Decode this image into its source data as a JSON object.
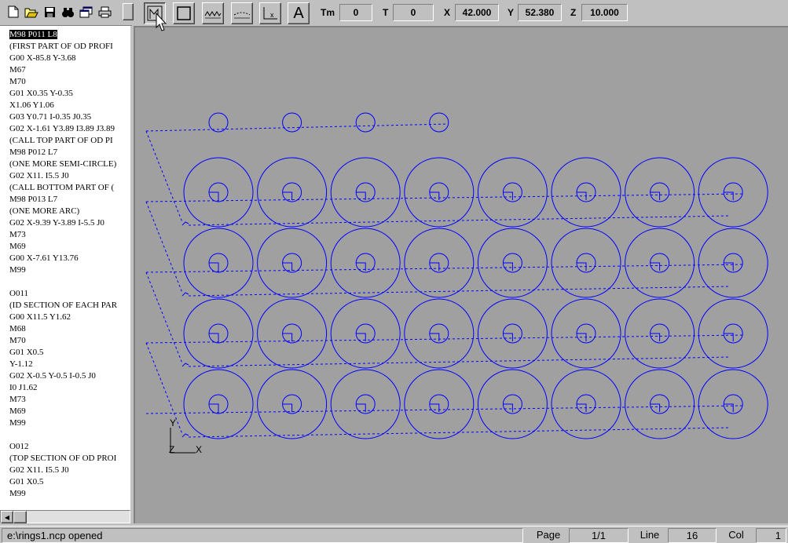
{
  "editor": {
    "lines": [
      "M98 P011 L8",
      "(FIRST PART OF OD PROFI",
      "G00 X-85.8 Y-3.68",
      "M67",
      "M70",
      "G01 X0.35 Y-0.35",
      "X1.06 Y1.06",
      "G03 Y0.71 I-0.35 J0.35",
      "G02 X-1.61 Y3.89 I3.89 J3.89",
      "(CALL TOP PART OF OD PI",
      "M98 P012 L7",
      "(ONE MORE SEMI-CIRCLE)",
      "G02 X11. I5.5 J0",
      "(CALL BOTTOM PART OF (",
      "M98 P013 L7",
      "(ONE MORE ARC)",
      "G02 X-9.39 Y-3.89 I-5.5 J0",
      "M73",
      "M69",
      "G00 X-7.61 Y13.76",
      "M99",
      "",
      "O011",
      "(ID SECTION OF EACH PAR",
      "G00 X11.5 Y1.62",
      "M68",
      "M70",
      "G01 X0.5",
      "Y-1.12",
      "G02 X-0.5 Y-0.5 I-0.5 J0",
      "I0 J1.62",
      "M73",
      "M69",
      "M99",
      "",
      "O012",
      "(TOP SECTION OF OD PROI",
      "G02 X11. I5.5 J0",
      "G01 X0.5",
      "M99"
    ],
    "selected_line": 0
  },
  "toolbar": {
    "buttons": [
      "new-file",
      "open-file",
      "save-file",
      "find",
      "copy-window",
      "print"
    ],
    "view_buttons": [
      "toolpath-view",
      "box-view",
      "wave-view",
      "dashed-view",
      "axis-view",
      "text-view"
    ],
    "text_button_label": "A",
    "tm_label": "Tm",
    "tm_value": "0",
    "t_label": "T",
    "t_value": "0",
    "x_label": "X",
    "x_value": "42.000",
    "y_label": "Y",
    "y_value": "52.380",
    "z_label": "Z",
    "z_value": "10.000"
  },
  "canvas": {
    "toolpath_color": "#0000ff",
    "axis_labels": {
      "y": "Y",
      "z": "Z",
      "x": "X"
    },
    "grid_rows": 4,
    "grid_cols": 8,
    "top_partial_count": 4
  },
  "status": {
    "message": "e:\\rings1.ncp opened",
    "page_label": "Page",
    "page_value": "1/1",
    "line_label": "Line",
    "line_value": "16",
    "col_label": "Col",
    "col_value": "1"
  }
}
